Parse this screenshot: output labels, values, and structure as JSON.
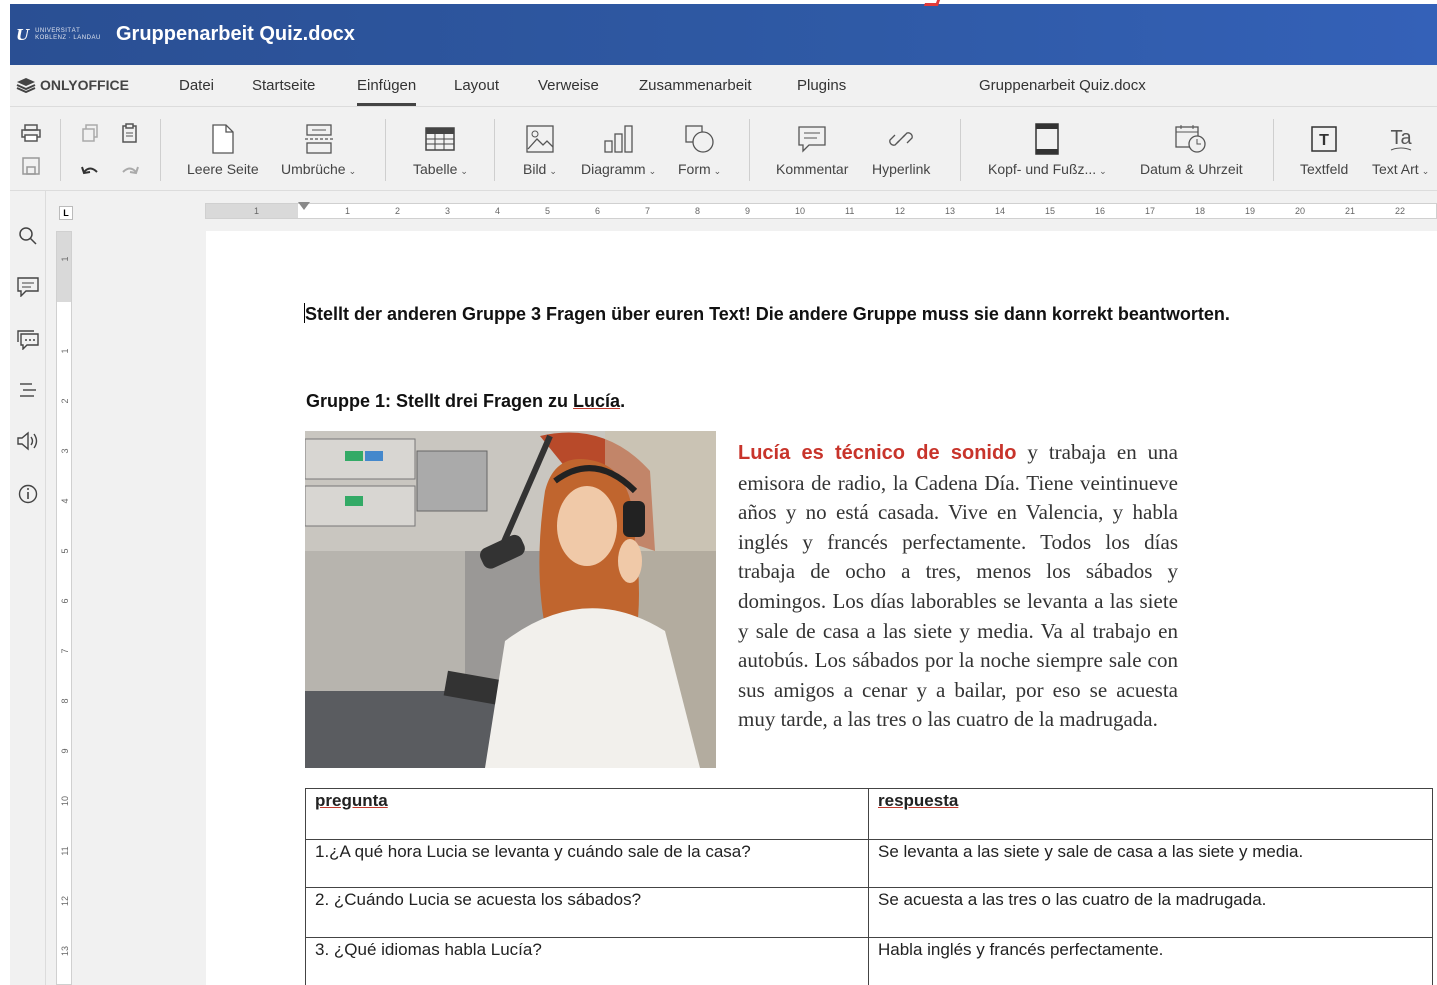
{
  "window": {
    "logo_text": "UNIVERSITÄT KOBLENZ · LANDAU",
    "title": "Gruppenarbeit Quiz.docx"
  },
  "menubar": {
    "brand": "ONLYOFFICE",
    "items": [
      "Datei",
      "Startseite",
      "Einfügen",
      "Layout",
      "Verweise",
      "Zusammenarbeit",
      "Plugins"
    ],
    "active": "Einfügen",
    "doc_title": "Gruppenarbeit Quiz.docx"
  },
  "toolbar": {
    "blank_page": "Leere Seite",
    "breaks": "Umbrüche",
    "table": "Tabelle",
    "image": "Bild",
    "chart": "Diagramm",
    "shape": "Form",
    "comment": "Kommentar",
    "hyperlink": "Hyperlink",
    "header_footer": "Kopf- und Fußz...",
    "date_time": "Datum & Uhrzeit",
    "textbox": "Textfeld",
    "text_art": "Text Art"
  },
  "ruler": {
    "corner": "L",
    "h_numbers": [
      "1",
      "1",
      "2",
      "3",
      "4",
      "5",
      "6",
      "7",
      "8",
      "9",
      "10",
      "11",
      "12",
      "13",
      "14",
      "15",
      "16",
      "17",
      "18",
      "19",
      "20",
      "21",
      "22"
    ],
    "v_numbers": [
      "1",
      "1",
      "2",
      "3",
      "4",
      "5",
      "6",
      "7",
      "8",
      "9",
      "10",
      "11",
      "12",
      "13"
    ]
  },
  "document": {
    "instruction": "Stellt der anderen Gruppe 3 Fragen über euren Text! Die andere Gruppe muss sie dann korrekt beantworten.",
    "group_prefix": "Gruppe 1: Stellt drei Fragen zu ",
    "group_name": "Lucía",
    "group_suffix": ".",
    "text_lead": "Lucía es técnico de sonido",
    "text_body": " y trabaja en una emisora de radio, la Cadena Día. Tiene veintinueve años y no está casada. Vive en Valencia, y habla inglés y francés perfectamente. Todos los días trabaja de ocho a tres, menos los sábados y domingos. Los días laborables se levanta a las siete y sale de casa a las siete y media. Va al trabajo en autobús. Los sábados por la noche siempre sale con sus amigos a cenar y a bailar, por eso se acuesta muy tarde, a las tres o las cuatro de la madrugada.",
    "table": {
      "header_q": "pregunta",
      "header_a": "respuesta",
      "q1": "1.¿A qué hora Lucia se levanta y cuándo sale de la casa?",
      "a1": "Se levanta a las siete y sale de casa a las siete y media.",
      "q2": "2.  ¿Cuándo Lucia se acuesta los sábados?",
      "a2": "Se acuesta a las tres o las cuatro de la madrugada.",
      "q3": "3. ¿Qué idiomas habla Lucía?",
      "a3": "Habla inglés y francés perfectamente."
    }
  }
}
